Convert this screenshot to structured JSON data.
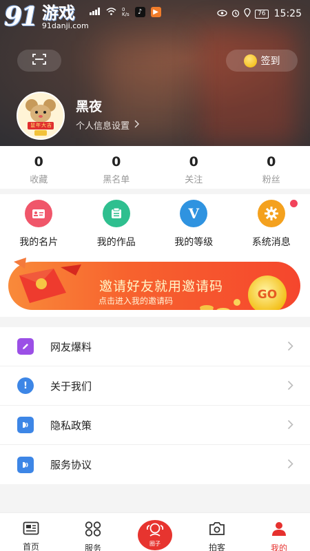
{
  "status_bar": {
    "brand_number": "91",
    "brand_name": "游戏",
    "brand_url": "91danji.com",
    "net_speed": "0\nK/s",
    "battery": "76",
    "time": "15:25"
  },
  "header": {
    "scan_icon": "scan-icon",
    "signin_label": "签到",
    "username": "黑夜",
    "profile_settings_label": "个人信息设置",
    "avatar_caption": "鼠年大吉"
  },
  "stats": [
    {
      "value": "0",
      "label": "收藏"
    },
    {
      "value": "0",
      "label": "黑名单"
    },
    {
      "value": "0",
      "label": "关注"
    },
    {
      "value": "0",
      "label": "粉丝"
    }
  ],
  "grid": [
    {
      "label": "我的名片",
      "icon": "id-card-icon",
      "color": "#f0566a"
    },
    {
      "label": "我的作品",
      "icon": "works-icon",
      "color": "#2fbf8f"
    },
    {
      "label": "我的等级",
      "icon": "level-icon",
      "color": "#2f93e0",
      "glyph": "V"
    },
    {
      "label": "系统消息",
      "icon": "gear-icon",
      "color": "#f4a11e"
    }
  ],
  "banner": {
    "title": "邀请好友就用邀请码",
    "subtitle": "点击进入我的邀请码",
    "go_label": "GO"
  },
  "menu": [
    {
      "label": "网友爆料",
      "icon": "edit-icon",
      "color": "#9b4fe6"
    },
    {
      "label": "关于我们",
      "icon": "info-icon",
      "color": "#3d86e6",
      "glyph": "!"
    },
    {
      "label": "隐私政策",
      "icon": "privacy-icon",
      "color": "#3d86e6"
    },
    {
      "label": "服务协议",
      "icon": "agreement-icon",
      "color": "#3d86e6"
    }
  ],
  "bottom_nav": [
    {
      "label": "首页",
      "icon": "home-news-icon"
    },
    {
      "label": "服务",
      "icon": "grid-services-icon"
    },
    {
      "label": "圈子",
      "icon": "circle-icon"
    },
    {
      "label": "拍客",
      "icon": "camera-icon"
    },
    {
      "label": "我的",
      "icon": "profile-icon",
      "active": true
    }
  ],
  "colors": {
    "accent": "#e6312e",
    "banner": "#f7632e",
    "text": "#222222",
    "muted": "#999999"
  }
}
